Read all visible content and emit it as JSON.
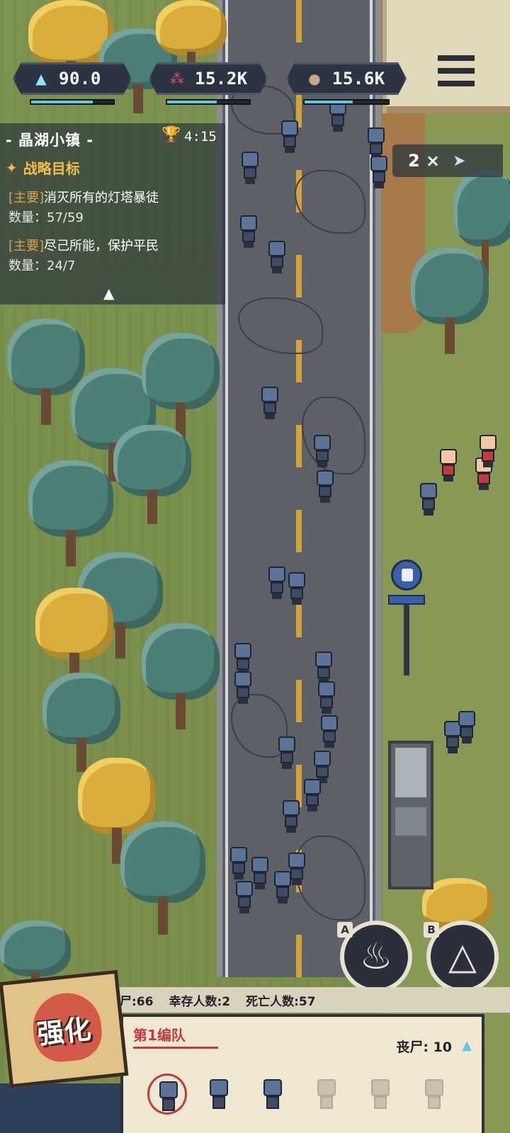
{
  "resources": {
    "mana": {
      "value": "90.0",
      "icon": "mana-triangle-icon",
      "fill": 0.75
    },
    "blood": {
      "value": "15.2K",
      "icon": "blood-drops-icon",
      "fill": 0.6
    },
    "brain": {
      "value": "15.6K",
      "icon": "brain-icon",
      "fill": 0.58
    }
  },
  "mission": {
    "town_name": "- 晶湖小镇 -",
    "timer": "4:15",
    "goals_header": "战略目标",
    "objectives": [
      {
        "tag": "[主要]",
        "text": "消灭所有的灯塔暴徒",
        "count": "数量：57/59"
      },
      {
        "tag": "[主要]",
        "text": "尽己所能，保护平民",
        "count": "数量：24/7"
      }
    ]
  },
  "speed": {
    "label": "2 ×"
  },
  "stats": {
    "zombies": "丧尸:66",
    "survivors": "幸存人数:2",
    "deaths": "死亡人数:57"
  },
  "squad": {
    "title": "第1编队",
    "zombie_count": "丧尸: 10"
  },
  "skills": {
    "a_key": "A",
    "b_key": "B"
  },
  "upgrade": {
    "label": "强化"
  },
  "colors": {
    "accent_red": "#c33a3a",
    "mana_cyan": "#63c9e6",
    "objective_gold": "#f2bd49"
  }
}
